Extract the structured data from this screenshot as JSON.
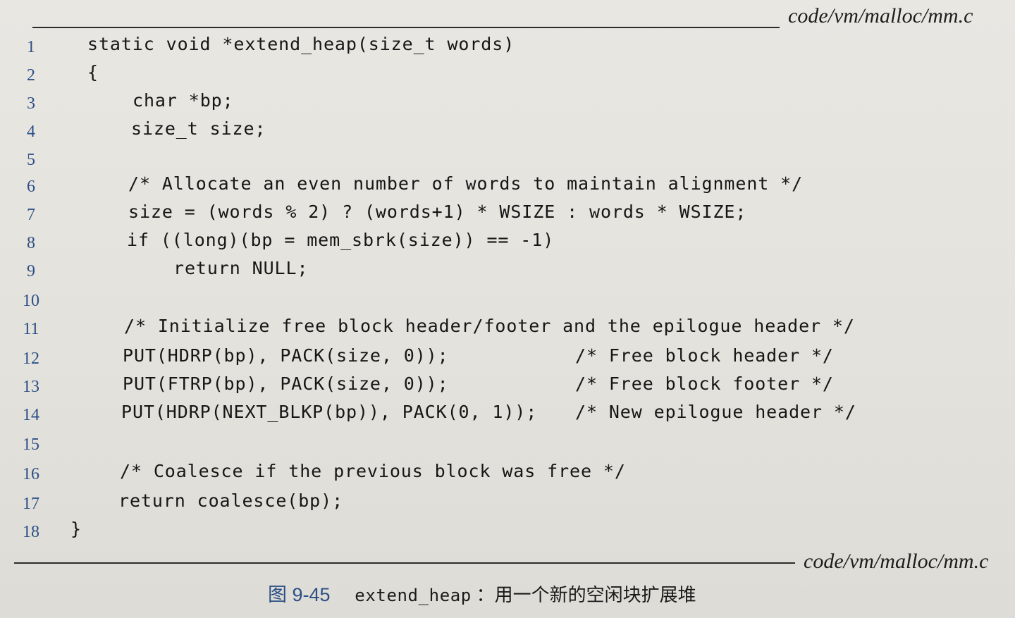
{
  "source_file": "code/vm/malloc/mm.c",
  "code": [
    {
      "num": "1",
      "text": "static void *extend_heap(size_t words)",
      "comment": ""
    },
    {
      "num": "2",
      "text": "{",
      "comment": ""
    },
    {
      "num": "3",
      "text": "char *bp;",
      "comment": ""
    },
    {
      "num": "4",
      "text": "size_t size;",
      "comment": ""
    },
    {
      "num": "5",
      "text": "",
      "comment": ""
    },
    {
      "num": "6",
      "text": "/* Allocate an even number of words to maintain alignment */",
      "comment": ""
    },
    {
      "num": "7",
      "text": "size = (words % 2) ? (words+1) * WSIZE : words * WSIZE;",
      "comment": ""
    },
    {
      "num": "8",
      "text": "if ((long)(bp = mem_sbrk(size)) == -1)",
      "comment": ""
    },
    {
      "num": "9",
      "text": "return NULL;",
      "comment": ""
    },
    {
      "num": "10",
      "text": "",
      "comment": ""
    },
    {
      "num": "11",
      "text": "/* Initialize free block header/footer and the epilogue header */",
      "comment": ""
    },
    {
      "num": "12",
      "text": "PUT(HDRP(bp), PACK(size, 0));",
      "comment": "/* Free block header */"
    },
    {
      "num": "13",
      "text": "PUT(FTRP(bp), PACK(size, 0));",
      "comment": "/* Free block footer */"
    },
    {
      "num": "14",
      "text": "PUT(HDRP(NEXT_BLKP(bp)), PACK(0, 1));",
      "comment": "/* New epilogue header */"
    },
    {
      "num": "15",
      "text": "",
      "comment": ""
    },
    {
      "num": "16",
      "text": "/* Coalesce if the previous block was free */",
      "comment": ""
    },
    {
      "num": "17",
      "text": "return coalesce(bp);",
      "comment": ""
    },
    {
      "num": "18",
      "text": "}",
      "comment": ""
    }
  ],
  "caption": {
    "figure_number": "图 9-45",
    "function_name": "extend_heap",
    "description": "：用一个新的空闲块扩展堆"
  }
}
